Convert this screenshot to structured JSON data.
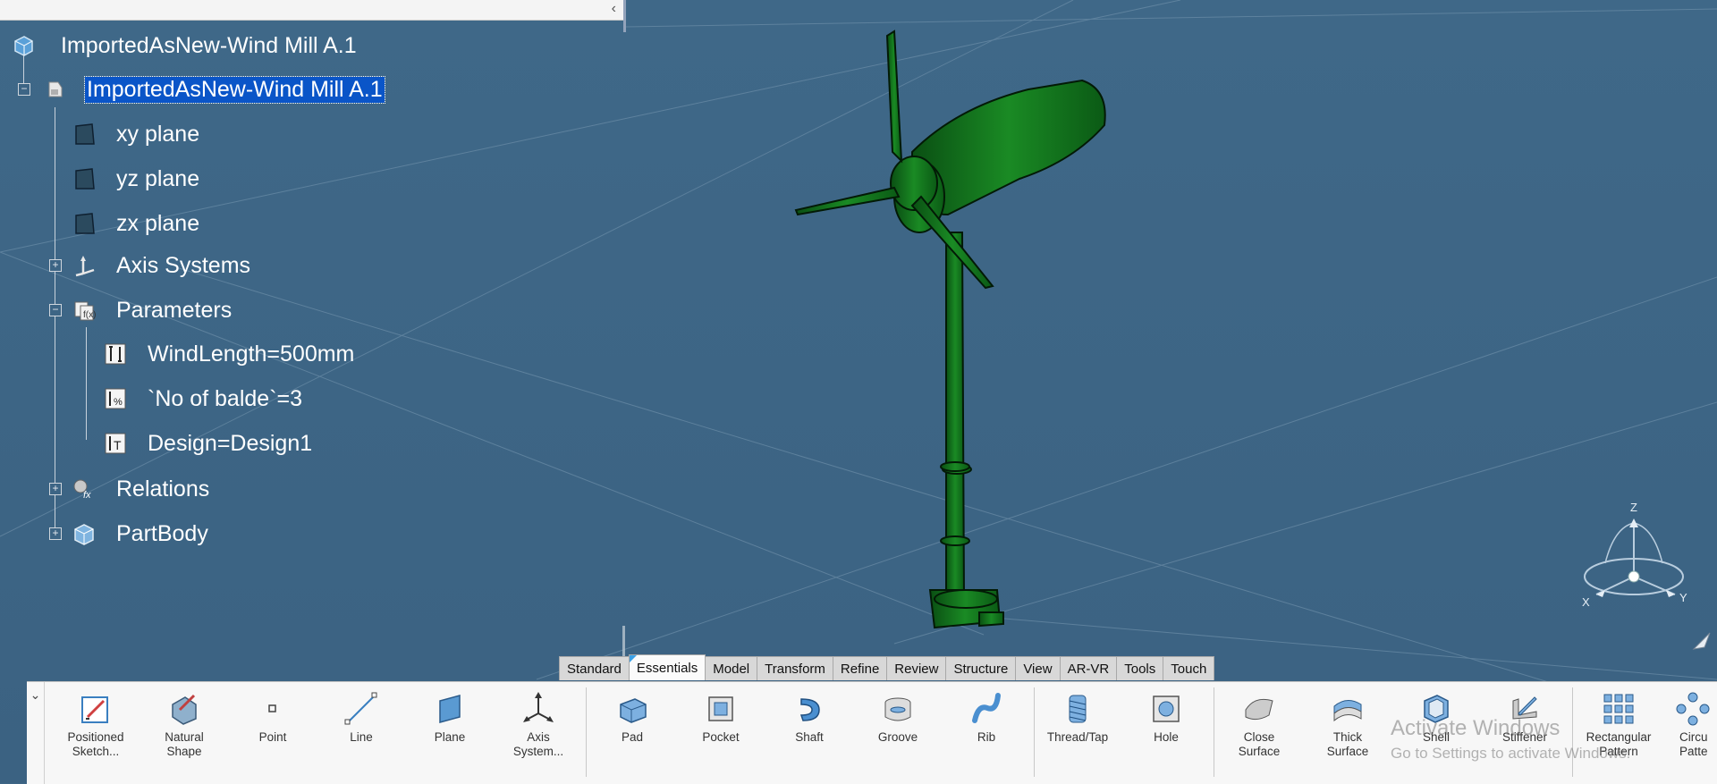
{
  "tree": {
    "root": "ImportedAsNew-Wind Mill A.1",
    "part": "ImportedAsNew-Wind Mill A.1",
    "planes": [
      "xy plane",
      "yz plane",
      "zx plane"
    ],
    "axis_systems": "Axis Systems",
    "parameters": "Parameters",
    "params": [
      "WindLength=500mm",
      "`No of balde`=3",
      "Design=Design1"
    ],
    "relations": "Relations",
    "partbody": "PartBody"
  },
  "tabs": [
    "Standard",
    "Essentials",
    "Model",
    "Transform",
    "Refine",
    "Review",
    "Structure",
    "View",
    "AR-VR",
    "Tools",
    "Touch"
  ],
  "active_tab": "Essentials",
  "toolbar": {
    "positioned_sketch": "Positioned\nSketch...",
    "natural_shape": "Natural\nShape",
    "point": "Point",
    "line": "Line",
    "plane": "Plane",
    "axis_system": "Axis\nSystem...",
    "pad": "Pad",
    "pocket": "Pocket",
    "shaft": "Shaft",
    "groove": "Groove",
    "rib": "Rib",
    "thread_tap": "Thread/Tap",
    "hole": "Hole",
    "close_surface": "Close\nSurface",
    "thick_surface": "Thick\nSurface",
    "shell": "Shell",
    "stiffener": "Stiffener",
    "rectangular_pattern": "Rectangular\nPattern",
    "circular_pattern": "Circu\nPatte"
  },
  "compass": {
    "z": "Z",
    "x": "X",
    "y": "Y"
  },
  "watermark": {
    "line1": "Activate Windows",
    "line2": "Go to Settings to activate Windows."
  },
  "colors": {
    "background": "#3d6585",
    "model": "#0f6b1a",
    "selection": "#0a55c8"
  }
}
